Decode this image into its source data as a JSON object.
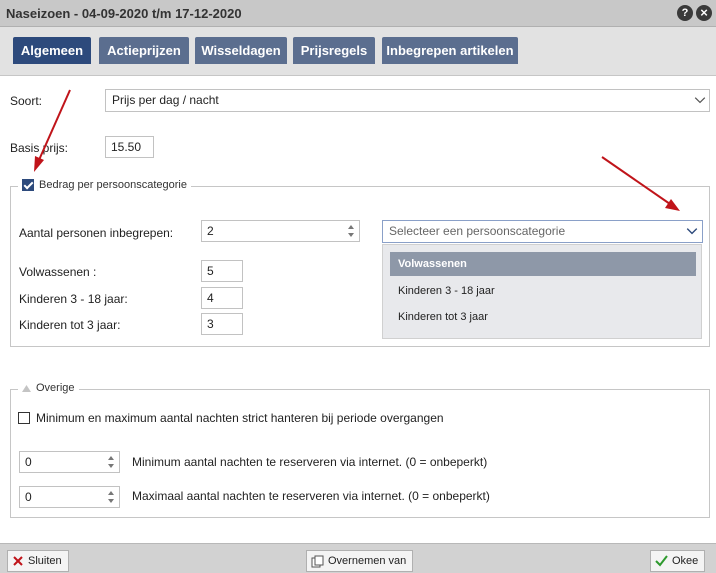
{
  "window": {
    "title": "Naseizoen - 04-09-2020 t/m 17-12-2020",
    "help_label": "?",
    "close_label": "×"
  },
  "tabs": [
    {
      "label": "Algemeen",
      "active": true
    },
    {
      "label": "Actieprijzen"
    },
    {
      "label": "Wisseldagen"
    },
    {
      "label": "Prijsregels"
    },
    {
      "label": "Inbegrepen artikelen"
    }
  ],
  "form": {
    "soort_label": "Soort:",
    "soort_value": "Prijs per dag / nacht",
    "basis_label": "Basis prijs:",
    "basis_value": "15.50"
  },
  "persoons": {
    "legend": "Bedrag per persoonscategorie",
    "checked": true,
    "aantal_label": "Aantal personen inbegrepen:",
    "aantal_value": "2",
    "select_placeholder": "Selecteer een persoonscategorie",
    "rows": [
      {
        "label": "Volwassenen :",
        "value": "5"
      },
      {
        "label": "Kinderen 3 - 18 jaar:",
        "value": "4"
      },
      {
        "label": "Kinderen tot 3 jaar:",
        "value": "3"
      }
    ],
    "dropdown_options": [
      {
        "label": "Volwassenen",
        "selected": true
      },
      {
        "label": "Kinderen 3 - 18 jaar"
      },
      {
        "label": "Kinderen tot 3 jaar"
      }
    ]
  },
  "overige": {
    "legend": "Overige",
    "strict_label": "Minimum en maximum aantal nachten strict hanteren bij periode overgangen",
    "min_value": "0",
    "min_label": "Minimum aantal nachten te reserveren via internet. (0 = onbeperkt)",
    "max_value": "0",
    "max_label": "Maximaal aantal nachten te reserveren via internet. (0 = onbeperkt)"
  },
  "footer": {
    "close_label": "Sluiten",
    "copy_label": "Overnemen van",
    "ok_label": "Okee"
  },
  "colors": {
    "tab_active": "#2d4a7c",
    "tab_inactive": "#5b6e8f",
    "arrow": "#c0141a"
  }
}
